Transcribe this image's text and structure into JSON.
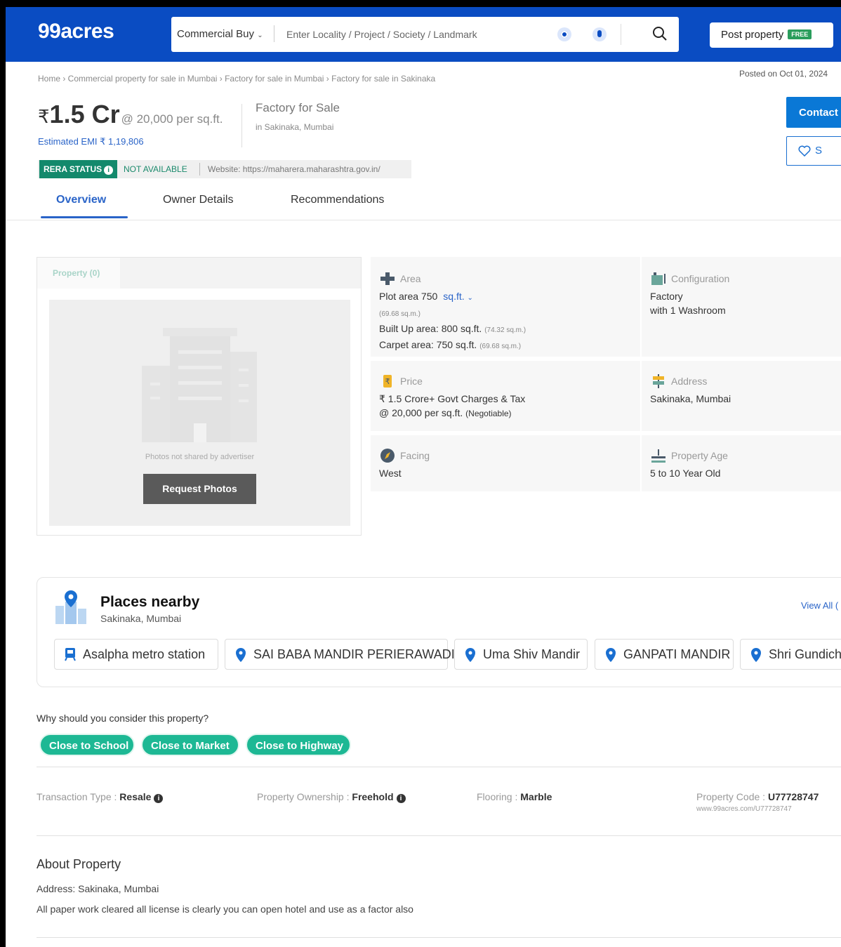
{
  "header": {
    "logo": "99acres",
    "category": "Commercial Buy",
    "search_placeholder": "Enter Locality / Project / Society / Landmark",
    "post_property": "Post property",
    "free_badge": "FREE"
  },
  "breadcrumb": "Home › Commercial property for sale in Mumbai › Factory for sale in Mumbai › Factory for sale in Sakinaka",
  "posted_on": "Posted on Oct 01, 2024",
  "price": {
    "currency": "₹",
    "amount": "1.5 Cr",
    "per_sqft": "@ 20,000 per sq.ft.",
    "emi": "Estimated EMI ₹ 1,19,806"
  },
  "property_type": "Factory for Sale",
  "property_location": "in Sakinaka, Mumbai",
  "actions": {
    "contact": "Contact",
    "shortlist": "S"
  },
  "rera": {
    "badge": "RERA STATUS",
    "status": "NOT AVAILABLE",
    "website": "Website: https://maharera.maharashtra.gov.in/"
  },
  "tabs": [
    "Overview",
    "Owner Details",
    "Recommendations"
  ],
  "photos": {
    "tab": "Property (0)",
    "note": "Photos not shared by advertiser",
    "request": "Request Photos"
  },
  "details": {
    "area": {
      "label": "Area",
      "plot": "Plot area 750",
      "unit": "sq.ft.",
      "plot_sqm": "(69.68 sq.m.)",
      "built_up": "Built Up area: 800 sq.ft.",
      "built_up_sqm": "(74.32 sq.m.)",
      "carpet": "Carpet area: 750 sq.ft.",
      "carpet_sqm": "(69.68 sq.m.)"
    },
    "configuration": {
      "label": "Configuration",
      "line1": "Factory",
      "line2": "with 1 Washroom"
    },
    "price": {
      "label": "Price",
      "line1": "₹ 1.5 Crore+ Govt Charges & Tax",
      "line2": "@ 20,000 per sq.ft.",
      "negotiable": "(Negotiable)"
    },
    "address": {
      "label": "Address",
      "value": "Sakinaka, Mumbai"
    },
    "facing": {
      "label": "Facing",
      "value": "West"
    },
    "age": {
      "label": "Property Age",
      "value": "5 to 10 Year Old"
    }
  },
  "places": {
    "title": "Places nearby",
    "subtitle": "Sakinaka, Mumbai",
    "view_all": "View All (",
    "items": [
      "Asalpha metro station",
      "SAI BABA MANDIR PERIERAWADI",
      "Uma Shiv Mandir",
      "GANPATI MANDIR",
      "Shri Gundich"
    ]
  },
  "why": {
    "title": "Why should you consider this property?",
    "tags": [
      "Close to School",
      "Close to Market",
      "Close to Highway"
    ]
  },
  "attributes": {
    "transaction_label": "Transaction Type :",
    "transaction_value": "Resale",
    "ownership_label": "Property Ownership :",
    "ownership_value": "Freehold",
    "flooring_label": "Flooring :",
    "flooring_value": "Marble",
    "code_label": "Property Code :",
    "code_value": "U77728747",
    "code_url": "www.99acres.com/U77728747"
  },
  "about": {
    "title": "About Property",
    "address": "Address: Sakinaka, Mumbai",
    "description": "All paper work cleared all license is clearly you can open hotel and use as a factor also"
  },
  "colors": {
    "brand": "#0a4cc2",
    "accent": "#2a64c8",
    "green": "#1db894",
    "rera": "#13896c"
  }
}
